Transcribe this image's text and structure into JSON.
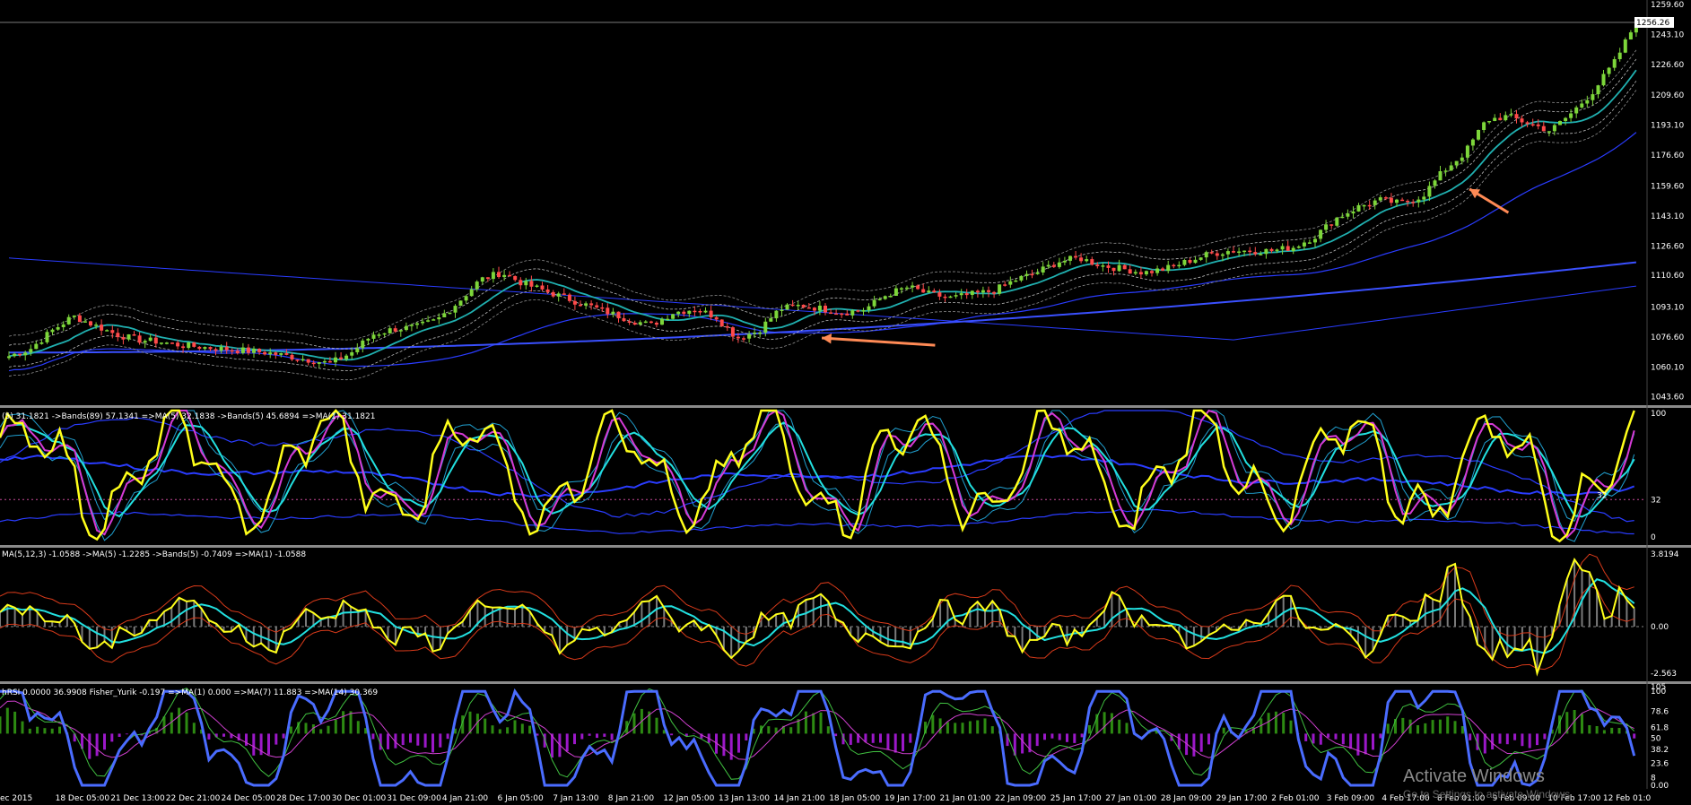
{
  "chart_data": {
    "type": "candlestick-with-indicators",
    "main": {
      "header": "",
      "price_badge": "1256.26",
      "yticks": [
        "1259.60",
        "1243.10",
        "1226.60",
        "1209.60",
        "1193.10",
        "1176.60",
        "1159.60",
        "1143.10",
        "1126.60",
        "1110.60",
        "1093.10",
        "1076.60",
        "1060.10",
        "1043.60"
      ],
      "ylim": [
        1040,
        1262
      ],
      "close_path": [
        1066,
        1070,
        1080,
        1088,
        1083,
        1078,
        1075,
        1074,
        1072,
        1071,
        1070,
        1069,
        1068,
        1066,
        1064,
        1062,
        1068,
        1078,
        1081,
        1082,
        1086,
        1096,
        1108,
        1112,
        1106,
        1102,
        1098,
        1094,
        1090,
        1086,
        1083,
        1090,
        1092,
        1088,
        1076,
        1080,
        1092,
        1094,
        1092,
        1090,
        1092,
        1100,
        1104,
        1100,
        1098,
        1100,
        1102,
        1108,
        1112,
        1118,
        1120,
        1116,
        1114,
        1112,
        1114,
        1118,
        1122,
        1124,
        1124,
        1124,
        1126,
        1132,
        1142,
        1148,
        1152,
        1150,
        1154,
        1168,
        1178,
        1196,
        1198,
        1194,
        1190,
        1200,
        1212,
        1228,
        1250
      ],
      "arrows": [
        {
          "x0": 0.553,
          "y0": 1072,
          "x1": 0.486,
          "y1": 1076
        },
        {
          "x0": 0.892,
          "y0": 1145,
          "x1": 0.869,
          "y1": 1158
        }
      ]
    },
    "rsi_panel": {
      "header": "(5) 31.1821 ->Bands(89) 57.1341 =>MA(5) 32.1838 ->Bands(5) 45.6894 =>MA(1) 31.1821",
      "yticks": [
        "100",
        "32",
        "0"
      ],
      "level_labels": [
        "32"
      ],
      "ylim": [
        0,
        100
      ]
    },
    "macd_panel": {
      "header": "MA(5,12,3) -1.0588 ->MA(5) -1.2285 ->Bands(5) -0.7409 =>MA(1) -1.0588",
      "yticks": [
        "3.8194",
        "0.00",
        "-2.563"
      ],
      "ylim": [
        -2.563,
        3.8194
      ]
    },
    "fisher_panel": {
      "header": "hRSI 0.0000 36.9908 Fisher_Yurik -0.197 =>MA(1) 0.000 =>MA(7) 11.883 =>MA(14) 30.369",
      "yticks": [
        "105",
        "100",
        "78.6",
        "61.8",
        "50",
        "38.2",
        "23.6",
        "8",
        "0.00"
      ],
      "ylim": [
        0,
        105
      ]
    },
    "x_labels": [
      "ec 2015",
      "18 Dec 05:00",
      "21 Dec 13:00",
      "22 Dec 21:00",
      "24 Dec 05:00",
      "28 Dec 17:00",
      "30 Dec 01:00",
      "31 Dec 09:00",
      "4 Jan 21:00",
      "6 Jan 05:00",
      "7 Jan 13:00",
      "8 Jan 21:00",
      "12 Jan 05:00",
      "13 Jan 13:00",
      "14 Jan 21:00",
      "18 Jan 05:00",
      "19 Jan 17:00",
      "21 Jan 01:00",
      "22 Jan 09:00",
      "25 Jan 17:00",
      "27 Jan 01:00",
      "28 Jan 09:00",
      "29 Jan 17:00",
      "2 Feb 01:00",
      "3 Feb 09:00",
      "4 Feb 17:00",
      "8 Feb 01:00",
      "9 Feb 09:00",
      "10 Feb 17:00",
      "12 Feb 01:0"
    ]
  },
  "watermark": {
    "line1": "Activate Windows",
    "line2": "Go to Settings to activate Windows."
  },
  "colors": {
    "bull": "#7dd63a",
    "bear": "#ff4a4a",
    "yellow": "#ffff1a",
    "cyan": "#22e0e0",
    "magenta": "#d63ad6",
    "blue": "#2a3cff",
    "teal": "#20b0b0",
    "orange": "#ff8a55",
    "green_hist": "#2d8a12",
    "purple_hist": "#9b18c8",
    "rsi_blue": "#4a6cff"
  }
}
